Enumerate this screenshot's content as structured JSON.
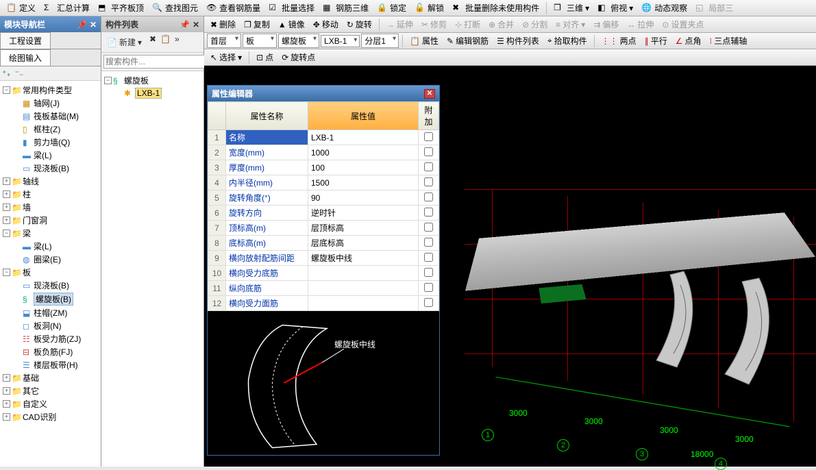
{
  "top_toolbar": {
    "define": "定义",
    "sum": "汇总计算",
    "align": "平齐板顶",
    "find": "查找图元",
    "rebar": "查看钢筋量",
    "batch_select": "批量选择",
    "rebar3d": "钢筋三维",
    "lock": "锁定",
    "unlock": "解锁",
    "batch_del": "批量删除未使用构件",
    "view3d": "三维",
    "topview": "俯视",
    "dynamic": "动态观察",
    "local3d": "局部三"
  },
  "edit_toolbar": {
    "delete": "删除",
    "copy": "复制",
    "mirror": "镜像",
    "move": "移动",
    "rotate": "旋转",
    "extend": "延伸",
    "trim": "修剪",
    "break": "打断",
    "merge": "合并",
    "split": "分割",
    "align": "对齐",
    "offset": "偏移",
    "stretch": "拉伸",
    "setpoint": "设置夹点"
  },
  "combo_toolbar": {
    "floor": "首层",
    "cat": "板",
    "type": "螺旋板",
    "name": "LXB-1",
    "layer": "分层1",
    "props": "属性",
    "editrebar": "编辑钢筋",
    "list": "构件列表",
    "pick": "拾取构件",
    "twopoint": "两点",
    "parallel": "平行",
    "angle": "点角",
    "threepoint": "三点辅轴"
  },
  "sel_toolbar": {
    "select": "选择",
    "point": "点",
    "rotpoint": "旋转点"
  },
  "nav_panel": {
    "title": "模块导航栏",
    "tab1": "工程设置",
    "tab2": "绘图输入",
    "root": "常用构件类型",
    "items": {
      "axis_net": "轴网(J)",
      "raft": "筏板基础(M)",
      "framecol": "框柱(Z)",
      "shearwall": "剪力墙(Q)",
      "beam": "梁(L)",
      "slab": "现浇板(B)",
      "grp_axis": "轴线",
      "grp_col": "柱",
      "grp_wall": "墙",
      "grp_opening": "门窗洞",
      "grp_beam": "梁",
      "beam2": "梁(L)",
      "ringbeam": "圈梁(E)",
      "grp_slab": "板",
      "castslab": "现浇板(B)",
      "spiral": "螺旋板(B)",
      "cap": "柱帽(ZM)",
      "hole": "板洞(N)",
      "slabrebar": "板受力筋(ZJ)",
      "negrebar": "板负筋(FJ)",
      "floorband": "楼层板带(H)",
      "grp_found": "基础",
      "grp_other": "其它",
      "grp_custom": "自定义",
      "grp_cad": "CAD识别"
    }
  },
  "list_panel": {
    "title": "构件列表",
    "new": "新建",
    "search_placeholder": "搜索构件...",
    "root": "螺旋板",
    "item": "LXB-1"
  },
  "prop_editor": {
    "title": "属性编辑器",
    "hdr_name": "属性名称",
    "hdr_val": "属性值",
    "hdr_extra": "附加",
    "rows": [
      {
        "n": "名称",
        "v": "LXB-1"
      },
      {
        "n": "宽度(mm)",
        "v": "1000"
      },
      {
        "n": "厚度(mm)",
        "v": "100"
      },
      {
        "n": "内半径(mm)",
        "v": "1500"
      },
      {
        "n": "旋转角度(°)",
        "v": "90"
      },
      {
        "n": "旋转方向",
        "v": "逆时针"
      },
      {
        "n": "顶标高(m)",
        "v": "层顶标高"
      },
      {
        "n": "底标高(m)",
        "v": "层底标高"
      },
      {
        "n": "横向放射配筋间距",
        "v": "螺旋板中线"
      },
      {
        "n": "横向受力底筋",
        "v": ""
      },
      {
        "n": "纵向底筋",
        "v": ""
      },
      {
        "n": "横向受力面筋",
        "v": ""
      }
    ],
    "preview_label": "螺旋板中线"
  },
  "scene": {
    "dims": [
      "3000",
      "3000",
      "3000",
      "3000"
    ],
    "total": "18000",
    "axes": [
      "1",
      "2",
      "3",
      "4"
    ]
  }
}
